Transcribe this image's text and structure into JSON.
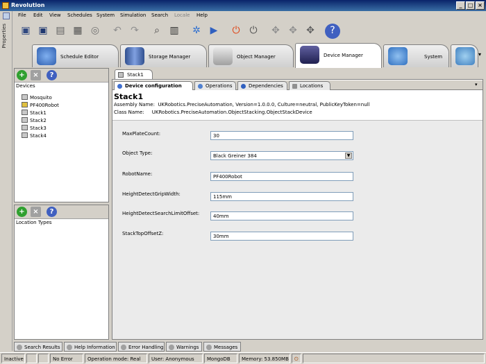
{
  "window": {
    "title": "Revolution",
    "icon": "app-icon"
  },
  "side_strip": {
    "label": "Properties",
    "icon": "properties-icon"
  },
  "menu": [
    "File",
    "Edit",
    "View",
    "Schedules",
    "System",
    "Simulation",
    "Search",
    "Locale",
    "Help"
  ],
  "toolbar": {
    "icons": [
      "save-icon",
      "save-all-icon",
      "folder-icon",
      "print-icon",
      "print-preview-icon",
      "undo-icon",
      "redo-icon",
      "search-icon",
      "barcode-icon",
      "run-icon",
      "play-icon",
      "stop-icon",
      "power-icon",
      "move-icon",
      "move2-icon",
      "move3-icon",
      "help-icon"
    ]
  },
  "modules": [
    {
      "label": "Schedule Editor",
      "icon": "schedule-editor-icon",
      "active": false
    },
    {
      "label": "Storage Manager",
      "icon": "storage-manager-icon",
      "active": false
    },
    {
      "label": "Object Manager",
      "icon": "object-manager-icon",
      "active": false
    },
    {
      "label": "Device Manager",
      "icon": "device-manager-icon",
      "active": true
    },
    {
      "label": "System",
      "icon": "system-icon",
      "active": false
    }
  ],
  "devices_panel": {
    "title": "Devices",
    "items": [
      "Mosquito",
      "PF400Robot",
      "Stack1",
      "Stack2",
      "Stack3",
      "Stack4"
    ]
  },
  "location_panel": {
    "title": "Location Types"
  },
  "document": {
    "tab_label": "Stack1",
    "subtabs": [
      "Device configuration",
      "Operations",
      "Dependencies",
      "Locations"
    ],
    "title": "Stack1",
    "assembly_label": "Assembly Name:",
    "assembly_value": "UKRobotics.PreciseAutomation, Version=1.0.0.0, Culture=neutral, PublicKeyToken=null",
    "class_label": "Class Name:",
    "class_value": "UKRobotics.PreciseAutomation.ObjectStacking.ObjectStackDevice",
    "fields": [
      {
        "label": "MaxPlateCount:",
        "value": "30",
        "type": "text"
      },
      {
        "label": "Object Type:",
        "value": "Black Greiner 384",
        "type": "select"
      },
      {
        "label": "RobotName:",
        "value": "PF400Robot",
        "type": "text"
      },
      {
        "label": "HeightDetectGripWidth:",
        "value": "115mm",
        "type": "text"
      },
      {
        "label": "HeightDetectSearchLimitOffset:",
        "value": "40mm",
        "type": "text"
      },
      {
        "label": "StackTopOffsetZ:",
        "value": "30mm",
        "type": "text"
      }
    ]
  },
  "bottom_tabs": [
    "Search Results",
    "Help Information",
    "Error Handling",
    "Warnings",
    "Messages"
  ],
  "status": {
    "state": "Inactive",
    "error": "No Error",
    "mode": "Operation mode: Real",
    "user": "User: Anonymous",
    "db": "MongoDB",
    "memory": "Memory: 53.850MB"
  },
  "colors": {
    "titlebar": "#0a246a",
    "add": "#30a030",
    "remove": "#a0a0a0",
    "help": "#4060c0",
    "stop": "#e04010"
  }
}
